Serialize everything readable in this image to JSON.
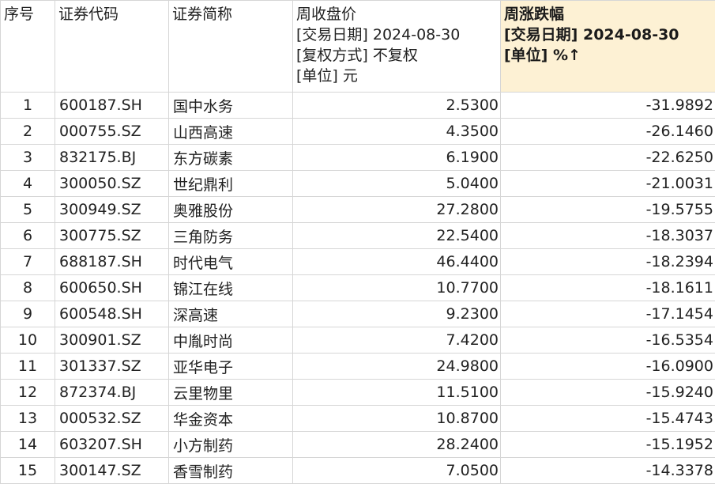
{
  "table": {
    "columns": [
      {
        "lines": [
          "序号"
        ]
      },
      {
        "lines": [
          "证券代码"
        ]
      },
      {
        "lines": [
          "证券简称"
        ]
      },
      {
        "lines": [
          "周收盘价",
          "[交易日期] 2024-08-30",
          "[复权方式] 不复权",
          "[单位] 元"
        ]
      },
      {
        "lines": [
          "周涨跌幅",
          "[交易日期] 2024-08-30",
          "[单位] %↑"
        ]
      }
    ],
    "sorted_column_color": "#fdf1d4",
    "rows": [
      {
        "idx": "1",
        "code": "600187.SH",
        "name": "国中水务",
        "close": "2.5300",
        "change": "-31.9892"
      },
      {
        "idx": "2",
        "code": "000755.SZ",
        "name": "山西高速",
        "close": "4.3500",
        "change": "-26.1460"
      },
      {
        "idx": "3",
        "code": "832175.BJ",
        "name": "东方碳素",
        "close": "6.1900",
        "change": "-22.6250"
      },
      {
        "idx": "4",
        "code": "300050.SZ",
        "name": "世纪鼎利",
        "close": "5.0400",
        "change": "-21.0031"
      },
      {
        "idx": "5",
        "code": "300949.SZ",
        "name": "奥雅股份",
        "close": "27.2800",
        "change": "-19.5755"
      },
      {
        "idx": "6",
        "code": "300775.SZ",
        "name": "三角防务",
        "close": "22.5400",
        "change": "-18.3037"
      },
      {
        "idx": "7",
        "code": "688187.SH",
        "name": "时代电气",
        "close": "46.4400",
        "change": "-18.2394"
      },
      {
        "idx": "8",
        "code": "600650.SH",
        "name": "锦江在线",
        "close": "10.7700",
        "change": "-18.1611"
      },
      {
        "idx": "9",
        "code": "600548.SH",
        "name": "深高速",
        "close": "9.2300",
        "change": "-17.1454"
      },
      {
        "idx": "10",
        "code": "300901.SZ",
        "name": "中胤时尚",
        "close": "7.4200",
        "change": "-16.5354"
      },
      {
        "idx": "11",
        "code": "301337.SZ",
        "name": "亚华电子",
        "close": "24.9800",
        "change": "-16.0900"
      },
      {
        "idx": "12",
        "code": "872374.BJ",
        "name": "云里物里",
        "close": "11.5100",
        "change": "-15.9240"
      },
      {
        "idx": "13",
        "code": "000532.SZ",
        "name": "华金资本",
        "close": "10.8700",
        "change": "-15.4743"
      },
      {
        "idx": "14",
        "code": "603207.SH",
        "name": "小方制药",
        "close": "28.2400",
        "change": "-15.1952"
      },
      {
        "idx": "15",
        "code": "300147.SZ",
        "name": "香雪制药",
        "close": "7.0500",
        "change": "-14.3378"
      }
    ]
  }
}
